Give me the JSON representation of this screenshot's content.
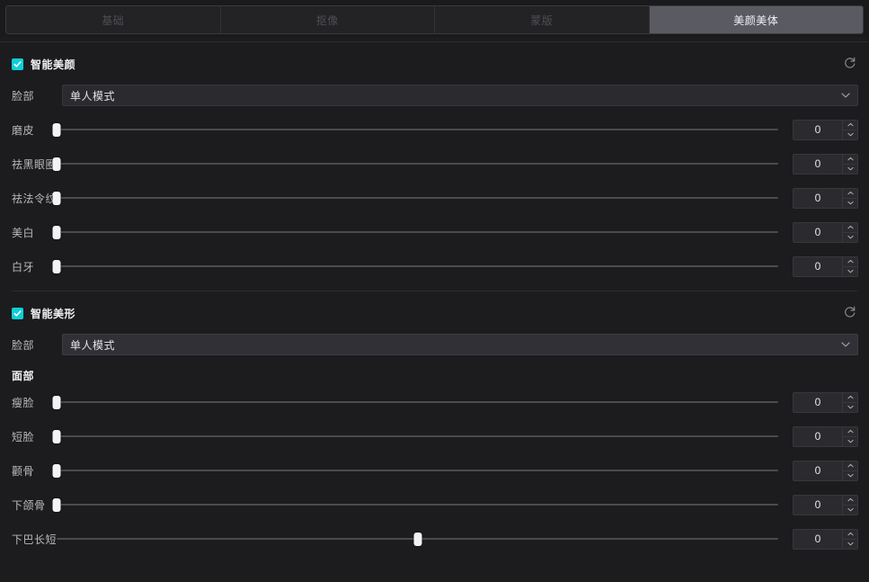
{
  "tabs": [
    {
      "label": "基础",
      "active": false,
      "name": "tab-basic"
    },
    {
      "label": "抠像",
      "active": false,
      "name": "tab-chromakey"
    },
    {
      "label": "蒙版",
      "active": false,
      "name": "tab-mask"
    },
    {
      "label": "美颜美体",
      "active": true,
      "name": "tab-beauty-body"
    }
  ],
  "sections": [
    {
      "name": "smart-beauty",
      "title": "智能美颜",
      "checked": true,
      "reset_icon": "reset-circular-arrow-icon",
      "dropdown": {
        "label": "脸部",
        "value": "单人模式",
        "caret_icon": "chevron-down-icon"
      },
      "group_label": null,
      "sliders": [
        {
          "label": "磨皮",
          "value": "0",
          "percent": 0
        },
        {
          "label": "祛黑眼圈",
          "value": "0",
          "percent": 0
        },
        {
          "label": "祛法令纹",
          "value": "0",
          "percent": 0
        },
        {
          "label": "美白",
          "value": "0",
          "percent": 0
        },
        {
          "label": "白牙",
          "value": "0",
          "percent": 0
        }
      ]
    },
    {
      "name": "smart-reshape",
      "title": "智能美形",
      "checked": true,
      "reset_icon": "reset-circular-arrow-icon",
      "dropdown": {
        "label": "脸部",
        "value": "单人模式",
        "caret_icon": "chevron-down-icon"
      },
      "group_label": "面部",
      "sliders": [
        {
          "label": "瘦脸",
          "value": "0",
          "percent": 0
        },
        {
          "label": "短脸",
          "value": "0",
          "percent": 0
        },
        {
          "label": "颧骨",
          "value": "0",
          "percent": 0
        },
        {
          "label": "下颌骨",
          "value": "0",
          "percent": 0
        },
        {
          "label": "下巴长短",
          "value": "0",
          "percent": 50
        }
      ]
    }
  ],
  "colors": {
    "accent": "#0fcfd8",
    "background": "#1c1c1e",
    "tab_active_bg": "#5a5a63",
    "slider_thumb": "#f3f3f5"
  }
}
